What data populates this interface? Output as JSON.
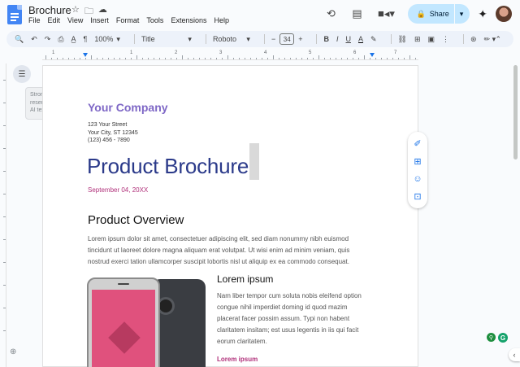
{
  "app": {
    "doc_title": "Brochure",
    "title_icons": [
      "star-icon",
      "folder-icon",
      "cloud-icon"
    ]
  },
  "menu": [
    "File",
    "Edit",
    "View",
    "Insert",
    "Format",
    "Tools",
    "Extensions",
    "Help"
  ],
  "header_right": {
    "share_label": "Share",
    "icons": [
      "history-icon",
      "comment-icon",
      "meet-icon",
      "gemini-icon",
      "avatar"
    ]
  },
  "toolbar": {
    "zoom": "100%",
    "style": "Title",
    "font": "Roboto",
    "font_size": "34",
    "minus": "−",
    "plus": "+",
    "bold": "B",
    "italic": "I",
    "underline": "U",
    "text_color": "A"
  },
  "ruler": {
    "numbers": [
      "1",
      "1",
      "2",
      "3",
      "4",
      "5",
      "6",
      "7"
    ]
  },
  "left_panel": {
    "ai_tip": "Strong resemblance to AI text"
  },
  "document": {
    "company": "Your Company",
    "address_lines": [
      "123 Your Street",
      "Your City, ST 12345",
      "(123) 456 - 7890"
    ],
    "title": "Product Brochure",
    "date": "September 04, 20XX",
    "overview_heading": "Product Overview",
    "overview_body": "Lorem ipsum dolor sit amet, consectetuer adipiscing elit, sed diam nonummy nibh euismod tincidunt ut laoreet dolore magna aliquam erat volutpat. Ut wisi enim ad minim veniam, quis nostrud exerci tation ullamcorper suscipit lobortis nisl ut aliquip ex ea commodo consequat.",
    "section_heading": "Lorem ipsum",
    "section_body": "Nam liber tempor cum soluta nobis eleifend option congue nihil imperdiet doming id quod mazim placerat facer possim assum. Typi non habent claritatem insitam; est usus legentis in iis qui facit eorum claritatem.",
    "section_subheading": "Lorem ipsum"
  },
  "colors": {
    "company": "#7e67c6",
    "title": "#2b3a8a",
    "accent_pink": "#b0307a",
    "share_bg": "#c2e7ff",
    "brand_blue": "#4285f4"
  }
}
